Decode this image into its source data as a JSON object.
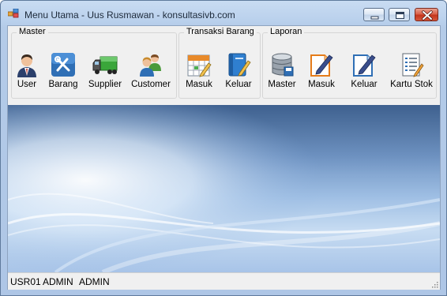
{
  "window": {
    "title": "Menu Utama - Uus Rusmawan - konsultasivb.com",
    "controls": {
      "minimize": "minimize",
      "maximize": "maximize",
      "close": "close"
    }
  },
  "toolbar": {
    "groups": [
      {
        "title": "Master",
        "items": [
          {
            "label": "User",
            "icon": "user-icon"
          },
          {
            "label": "Barang",
            "icon": "tools-icon"
          },
          {
            "label": "Supplier",
            "icon": "truck-icon"
          },
          {
            "label": "Customer",
            "icon": "customers-icon"
          }
        ]
      },
      {
        "title": "Transaksi Barang",
        "items": [
          {
            "label": "Masuk",
            "icon": "calendar-icon"
          },
          {
            "label": "Keluar",
            "icon": "notebook-pen-icon"
          }
        ]
      },
      {
        "title": "Laporan",
        "items": [
          {
            "label": "Master",
            "icon": "database-icon"
          },
          {
            "label": "Masuk",
            "icon": "document-pen-orange-icon"
          },
          {
            "label": "Keluar",
            "icon": "document-pen-blue-icon"
          },
          {
            "label": "Kartu Stok",
            "icon": "report-list-icon"
          }
        ]
      }
    ]
  },
  "status": {
    "user_id": "USR01",
    "user_name": "ADMIN",
    "user_level": "ADMIN"
  },
  "colors": {
    "title_bar": "#b9d0ec",
    "close_button": "#d9604a",
    "background_blue": "#9fbfe4"
  }
}
